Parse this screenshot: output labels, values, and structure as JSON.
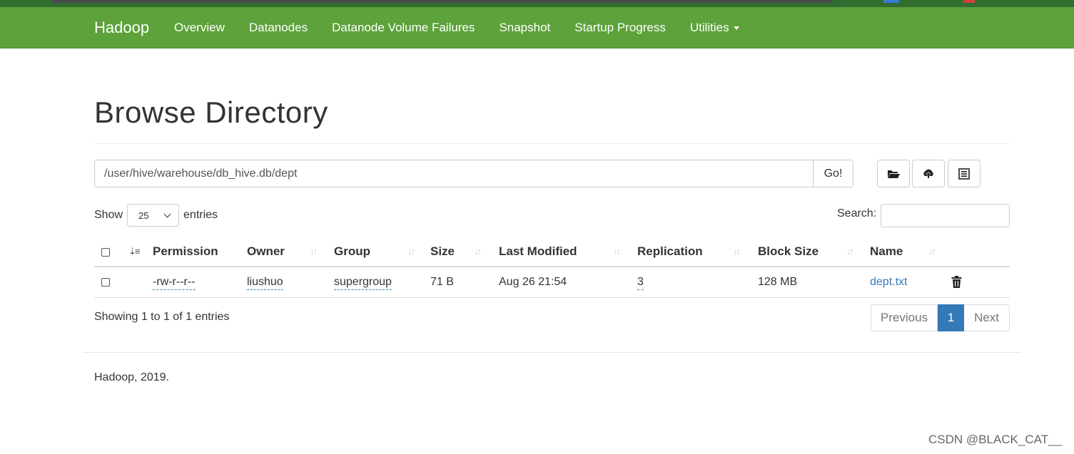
{
  "navbar": {
    "brand": "Hadoop",
    "links": [
      "Overview",
      "Datanodes",
      "Datanode Volume Failures",
      "Snapshot",
      "Startup Progress",
      "Utilities"
    ]
  },
  "page": {
    "title": "Browse Directory",
    "path_value": "/user/hive/warehouse/db_hive.db/dept",
    "go_label": "Go!",
    "icons": [
      "folder-open-icon",
      "cloud-upload-icon",
      "list-alt-icon"
    ]
  },
  "controls": {
    "show_label": "Show",
    "entries_value": "25",
    "entries_label": "entries",
    "search_label": "Search:",
    "search_value": ""
  },
  "table": {
    "columns": [
      "Permission",
      "Owner",
      "Group",
      "Size",
      "Last Modified",
      "Replication",
      "Block Size",
      "Name"
    ],
    "rows": [
      {
        "permission": "-rw-r--r--",
        "owner": "liushuo",
        "group": "supergroup",
        "size": "71 B",
        "last_modified": "Aug 26 21:54",
        "replication": "3",
        "block_size": "128 MB",
        "name": "dept.txt"
      }
    ]
  },
  "footer_info": {
    "showing": "Showing 1 to 1 of 1 entries",
    "prev_label": "Previous",
    "current_page": "1",
    "next_label": "Next",
    "copyright": "Hadoop, 2019.",
    "watermark": "CSDN @BLACK_CAT__"
  },
  "colors": {
    "navbar": "#5da23a",
    "link": "#337ab7",
    "active_page": "#337ab7"
  }
}
